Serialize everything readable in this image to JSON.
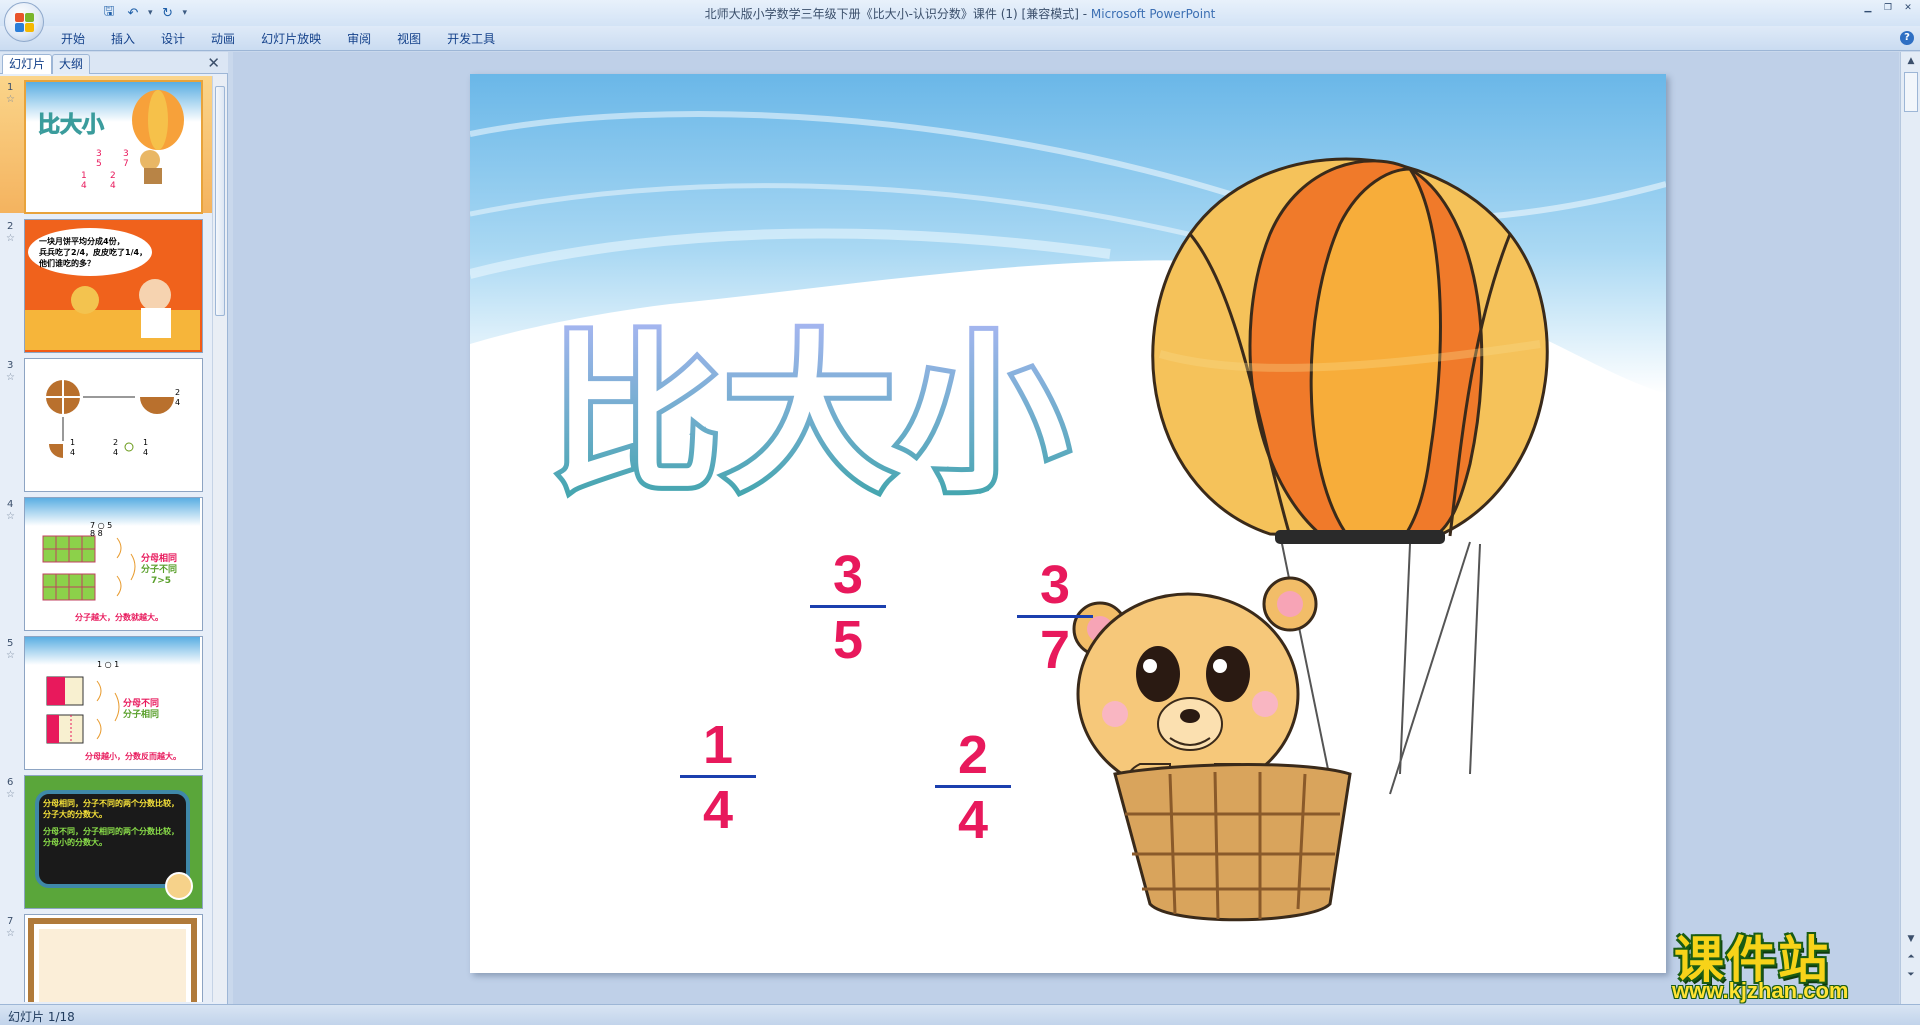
{
  "window": {
    "title": "北师大版小学数学三年级下册《比大小-认识分数》课件 (1) [兼容模式] - ",
    "app_name": "Microsoft PowerPoint"
  },
  "quick_access": [
    {
      "name": "save-icon",
      "glyph": "🖫"
    },
    {
      "name": "undo-icon",
      "glyph": "↶"
    },
    {
      "name": "redo-icon",
      "glyph": "↻"
    }
  ],
  "ribbon": {
    "tabs": [
      "开始",
      "插入",
      "设计",
      "动画",
      "幻灯片放映",
      "审阅",
      "视图",
      "开发工具"
    ]
  },
  "left_panel": {
    "tab_slides": "幻灯片",
    "tab_outline": "大纲",
    "close": "✕",
    "thumbnails": [
      {
        "num": "1"
      },
      {
        "num": "2",
        "text": [
          "一块月饼平均分成4份，",
          "兵兵吃了2/4，皮皮吃了1/4，",
          "他们谁吃的多？"
        ]
      },
      {
        "num": "3"
      },
      {
        "num": "4",
        "text": [
          "分母相同",
          "分子不同",
          "7>5",
          "分子越大，分数就越大。"
        ]
      },
      {
        "num": "5",
        "text": [
          "分母不同",
          "分子相同",
          "分母越小，分数反而越大。"
        ]
      },
      {
        "num": "6",
        "text": [
          "分母相同，分子不同的两个分数比较，分子大的分数大。",
          "分母不同，分子相同的两个分数比较，分母小的分数大。"
        ]
      },
      {
        "num": "7"
      }
    ]
  },
  "slide": {
    "title": "比大小",
    "fractions": [
      {
        "numerator": "3",
        "denominator": "5"
      },
      {
        "numerator": "3",
        "denominator": "7"
      },
      {
        "numerator": "1",
        "denominator": "4"
      },
      {
        "numerator": "2",
        "denominator": "4"
      }
    ],
    "colors": {
      "fraction": "#e8195c",
      "bar": "#1b3fae",
      "title_top": "#8fa7e8",
      "title_bottom": "#35a6a6"
    }
  },
  "status": {
    "text": "幻灯片 1/18"
  },
  "watermark": {
    "big": "课件站",
    "url": "www.kjzhan.com"
  }
}
